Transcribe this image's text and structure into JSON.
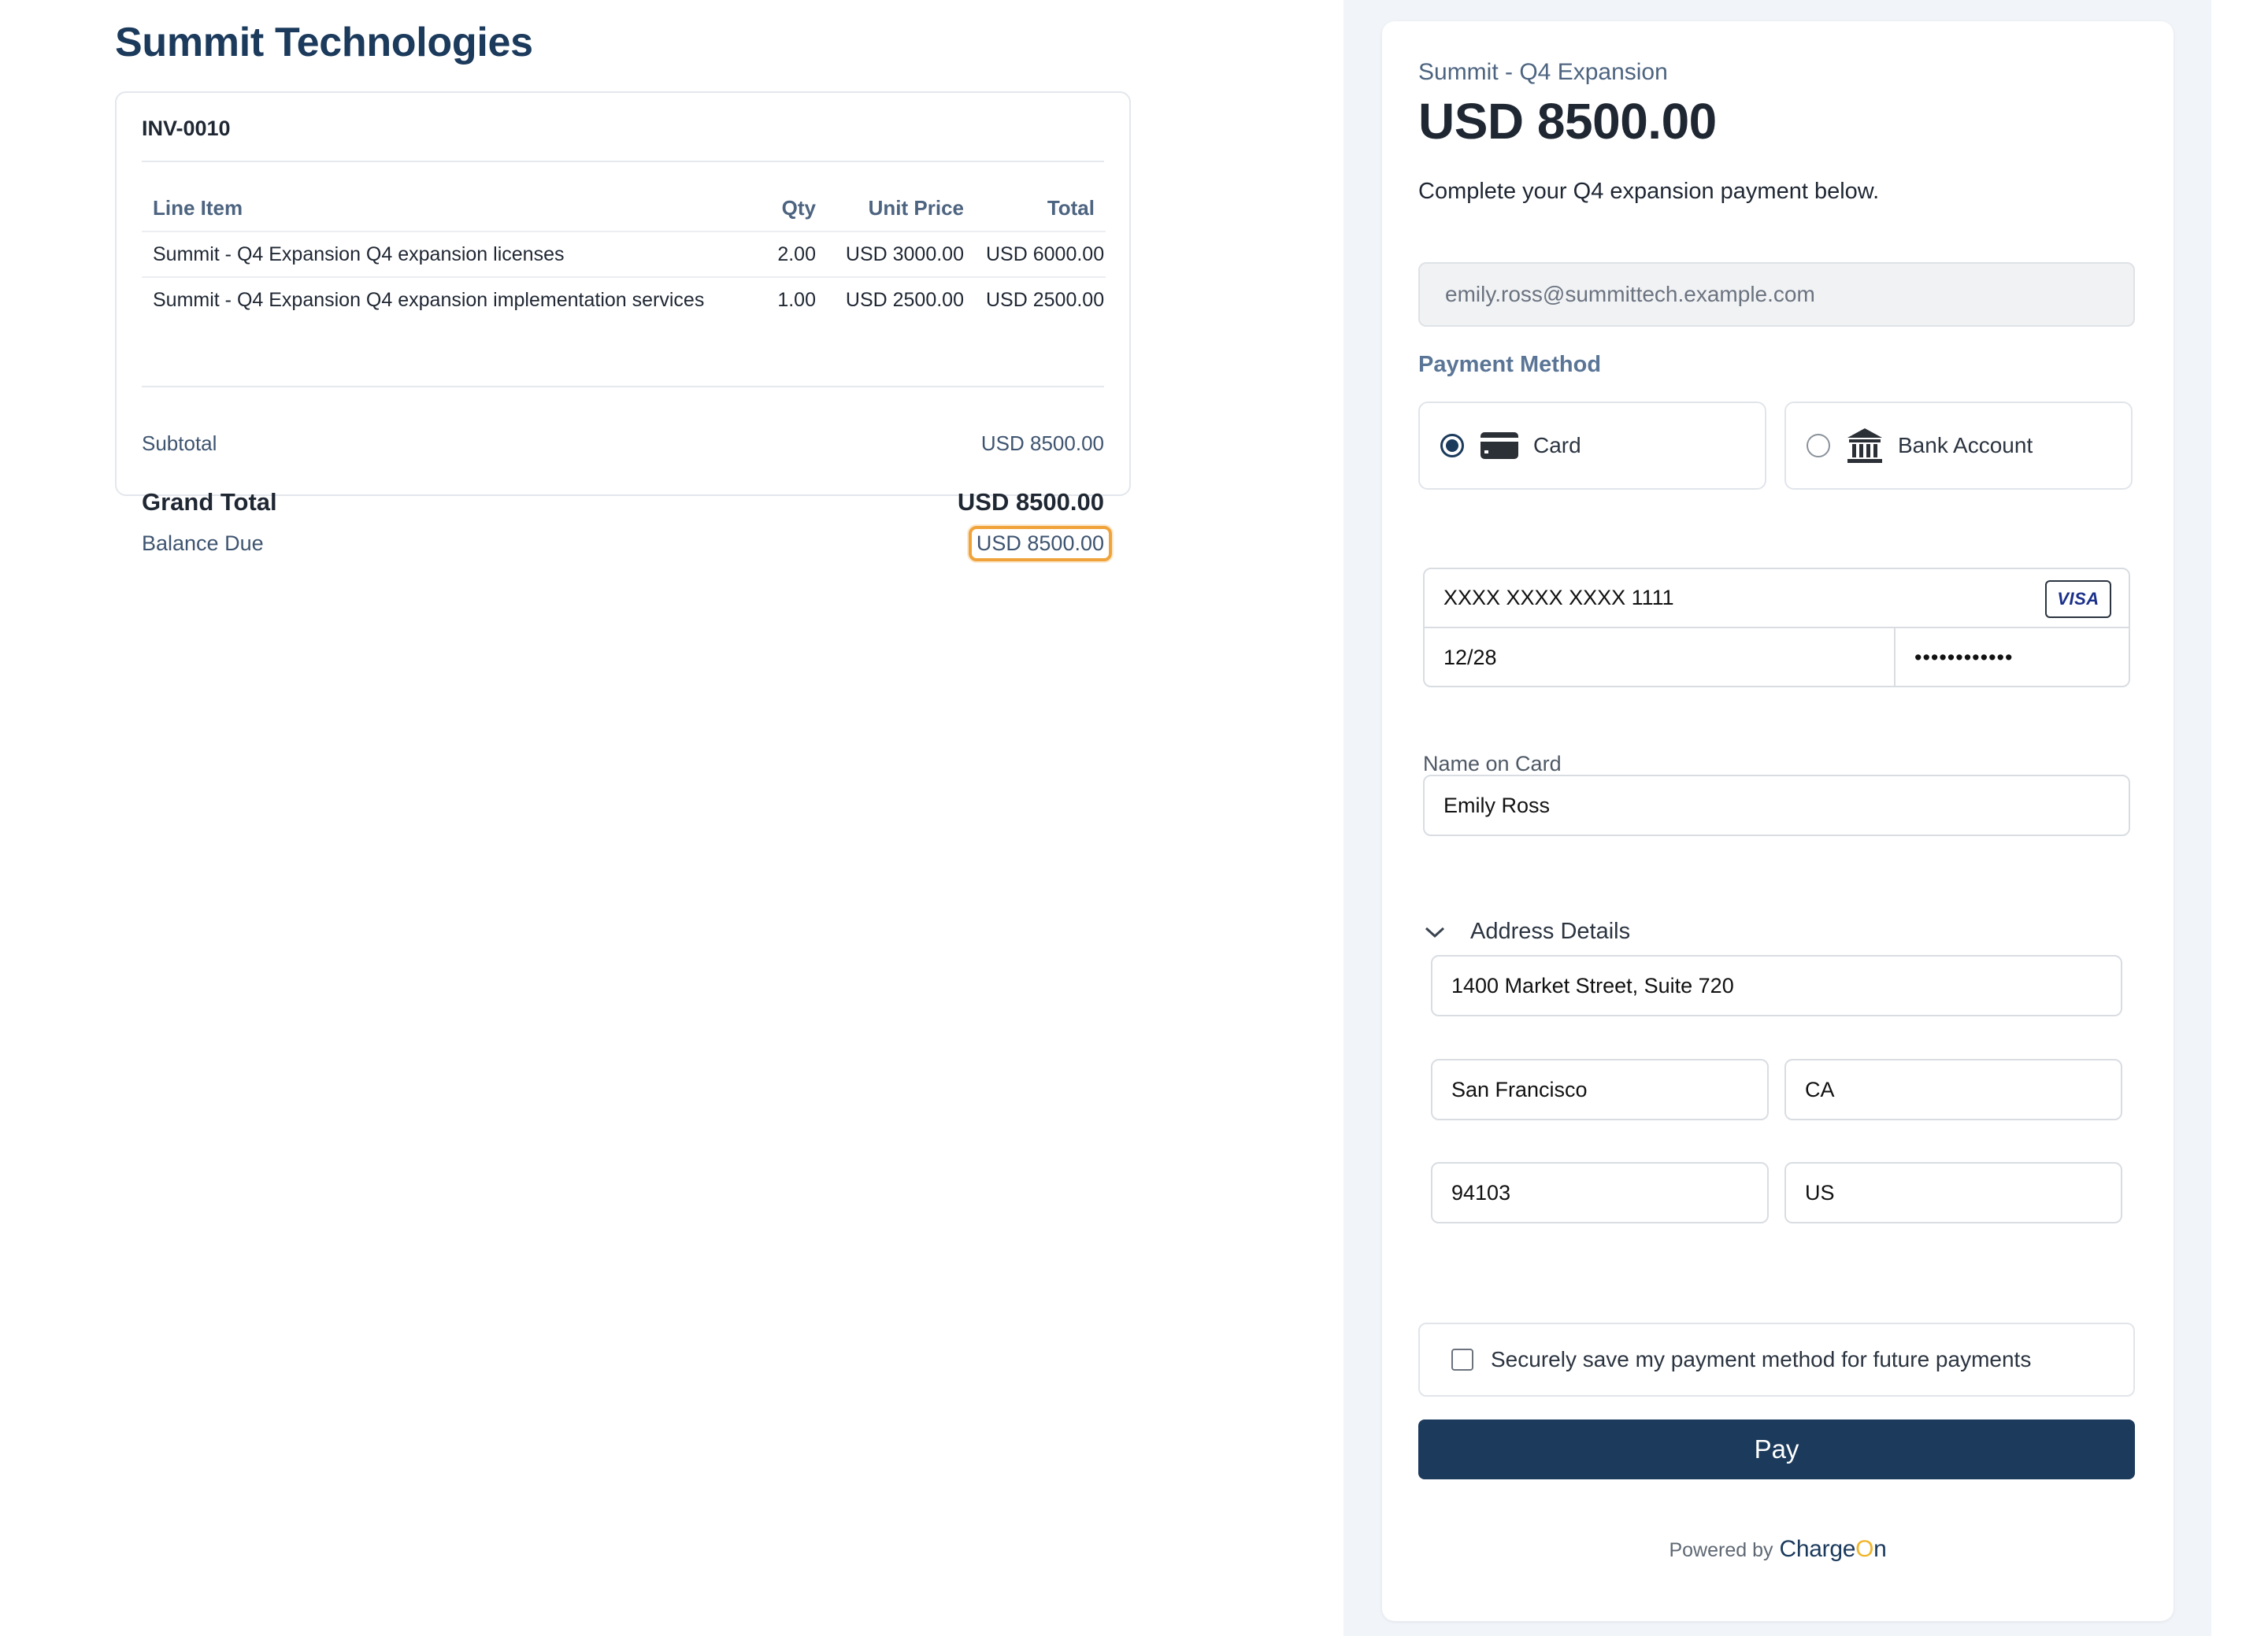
{
  "company": {
    "name": "Summit Technologies"
  },
  "invoice": {
    "number": "INV-0010",
    "columns": {
      "item": "Line Item",
      "qty": "Qty",
      "unit_price": "Unit Price",
      "total": "Total"
    },
    "lines": [
      {
        "item": "Summit - Q4 Expansion Q4 expansion licenses",
        "qty": "2.00",
        "unit_price": "USD 3000.00",
        "total": "USD 6000.00"
      },
      {
        "item": "Summit - Q4 Expansion Q4 expansion implementation services",
        "qty": "1.00",
        "unit_price": "USD 2500.00",
        "total": "USD 2500.00"
      }
    ],
    "subtotal_label": "Subtotal",
    "subtotal_value": "USD 8500.00",
    "grand_total_label": "Grand Total",
    "grand_total_value": "USD 8500.00",
    "balance_due_label": "Balance Due",
    "balance_due_value": "USD 8500.00"
  },
  "payment": {
    "description": "Summit - Q4 Expansion",
    "amount": "USD 8500.00",
    "note": "Complete your Q4 expansion payment below.",
    "email": "emily.ross@summittech.example.com",
    "method_label": "Payment Method",
    "methods": {
      "card": "Card",
      "bank": "Bank Account"
    },
    "selected_method": "card",
    "card": {
      "number": "XXXX XXXX XXXX 1111",
      "brand": "VISA",
      "expiry": "12/28",
      "cvc": "••••••••••••"
    },
    "name_on_card_label": "Name on Card",
    "name_on_card": "Emily Ross",
    "address_details_label": "Address Details",
    "address": {
      "line1": "1400 Market Street, Suite 720",
      "city": "San Francisco",
      "state": "CA",
      "postal_code": "94103",
      "country": "US"
    },
    "save_method_label": "Securely save my payment method for future payments",
    "pay_button": "Pay",
    "powered_by": "Powered by",
    "brand_prefix": "Charge",
    "brand_accent": "O",
    "brand_suffix": "n"
  },
  "colors": {
    "primary": "#1b3a5c",
    "highlight": "#f0a33a",
    "panel_background": "#f1f4f8"
  }
}
